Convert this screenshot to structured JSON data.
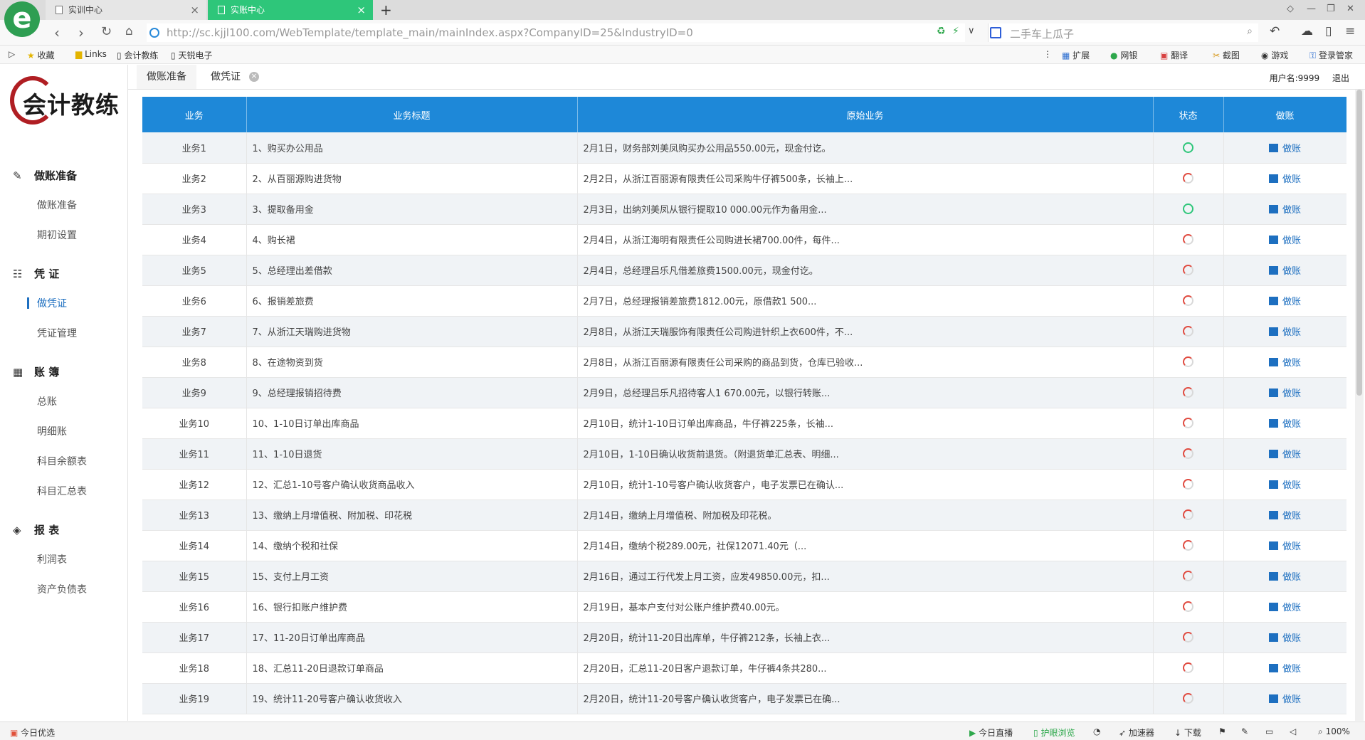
{
  "browser": {
    "tabs": [
      {
        "label": "实训中心"
      },
      {
        "label": "实账中心"
      }
    ],
    "url": "http://sc.kjjl100.com/WebTemplate/template_main/mainIndex.aspx?CompanyID=25&IndustryID=0",
    "search_placeholder": "二手车上瓜子",
    "favorites": [
      "收藏",
      "Links",
      "会计教练",
      "天锐电子"
    ],
    "extensions": [
      "扩展",
      "网银",
      "翻译",
      "截图",
      "游戏",
      "登录管家"
    ]
  },
  "app": {
    "logo_text": "会计教练",
    "sidebar": {
      "sections": [
        {
          "title": "做账准备",
          "icon": "edit-icon",
          "items": [
            "做账准备",
            "期初设置"
          ]
        },
        {
          "title": "凭 证",
          "icon": "list-icon",
          "items": [
            "做凭证",
            "凭证管理"
          ]
        },
        {
          "title": "账 簿",
          "icon": "calendar-icon",
          "items": [
            "总账",
            "明细账",
            "科目余额表",
            "科目汇总表"
          ]
        },
        {
          "title": "报 表",
          "icon": "layers-icon",
          "items": [
            "利润表",
            "资产负债表"
          ]
        }
      ],
      "active_item": "做凭证"
    },
    "page_tabs": [
      {
        "label": "做账准备"
      },
      {
        "label": "做凭证"
      }
    ],
    "user": {
      "name_label": "用户名:9999",
      "logout": "退出"
    },
    "table": {
      "columns": [
        "业务",
        "业务标题",
        "原始业务",
        "状态",
        "做账"
      ],
      "action_label": "做账",
      "rows": [
        {
          "id": "业务1",
          "title": "1、购买办公用品",
          "desc": "2月1日，财务部刘美凤购买办公用品550.00元，现金付讫。",
          "status": "done"
        },
        {
          "id": "业务2",
          "title": "2、从百丽源购进货物",
          "desc": "2月2日，从浙江百丽源有限责任公司采购牛仔裤500条，长袖上...",
          "status": "todo"
        },
        {
          "id": "业务3",
          "title": "3、提取备用金",
          "desc": "2月3日，出纳刘美凤从银行提取10 000.00元作为备用金...",
          "status": "done"
        },
        {
          "id": "业务4",
          "title": "4、购长裙",
          "desc": "2月4日，从浙江海明有限责任公司购进长裙700.00件，每件...",
          "status": "todo"
        },
        {
          "id": "业务5",
          "title": "5、总经理出差借款",
          "desc": "2月4日，总经理吕乐凡借差旅费1500.00元，现金付讫。",
          "status": "todo"
        },
        {
          "id": "业务6",
          "title": "6、报销差旅费",
          "desc": "2月7日，总经理报销差旅费1812.00元，原借款1 500...",
          "status": "todo"
        },
        {
          "id": "业务7",
          "title": "7、从浙江天瑞购进货物",
          "desc": "2月8日，从浙江天瑞服饰有限责任公司购进针织上衣600件，不...",
          "status": "todo"
        },
        {
          "id": "业务8",
          "title": "8、在途物资到货",
          "desc": "2月8日，从浙江百丽源有限责任公司采购的商品到货，仓库已验收...",
          "status": "todo"
        },
        {
          "id": "业务9",
          "title": "9、总经理报销招待费",
          "desc": "2月9日，总经理吕乐凡招待客人1 670.00元，以银行转账...",
          "status": "todo"
        },
        {
          "id": "业务10",
          "title": "10、1-10日订单出库商品",
          "desc": "2月10日，统计1-10日订单出库商品，牛仔裤225条，长袖...",
          "status": "todo"
        },
        {
          "id": "业务11",
          "title": "11、1-10日退货",
          "desc": "2月10日，1-10日确认收货前退货。（附退货单汇总表、明细...",
          "status": "todo"
        },
        {
          "id": "业务12",
          "title": "12、汇总1-10号客户确认收货商品收入",
          "desc": "2月10日，统计1-10号客户确认收货客户，电子发票已在确认...",
          "status": "todo"
        },
        {
          "id": "业务13",
          "title": "13、缴纳上月增值税、附加税、印花税",
          "desc": "2月14日，缴纳上月增值税、附加税及印花税。",
          "status": "todo"
        },
        {
          "id": "业务14",
          "title": "14、缴纳个税和社保",
          "desc": "2月14日，缴纳个税289.00元，社保12071.40元（...",
          "status": "todo"
        },
        {
          "id": "业务15",
          "title": "15、支付上月工资",
          "desc": "2月16日，通过工行代发上月工资，应发49850.00元，扣...",
          "status": "todo"
        },
        {
          "id": "业务16",
          "title": "16、银行扣账户维护费",
          "desc": "2月19日，基本户支付对公账户维护费40.00元。",
          "status": "todo"
        },
        {
          "id": "业务17",
          "title": "17、11-20日订单出库商品",
          "desc": "2月20日，统计11-20日出库单，牛仔裤212条，长袖上衣...",
          "status": "todo"
        },
        {
          "id": "业务18",
          "title": "18、汇总11-20日退款订单商品",
          "desc": "2月20日，汇总11-20日客户退款订单，牛仔裤4条共280...",
          "status": "todo"
        },
        {
          "id": "业务19",
          "title": "19、统计11-20号客户确认收货收入",
          "desc": "2月20日，统计11-20号客户确认收货客户，电子发票已在确...",
          "status": "todo"
        }
      ]
    }
  },
  "statusbar": {
    "left": "今日优选",
    "items": [
      "今日直播",
      "护眼浏览",
      "加速器",
      "下载",
      "100%"
    ]
  },
  "colors": {
    "header_blue": "#1e88d8",
    "active_tab_green": "#2ec67a",
    "done_green": "#2ec67a",
    "todo_red": "#e04a3f",
    "link_blue": "#1d6fc0"
  }
}
